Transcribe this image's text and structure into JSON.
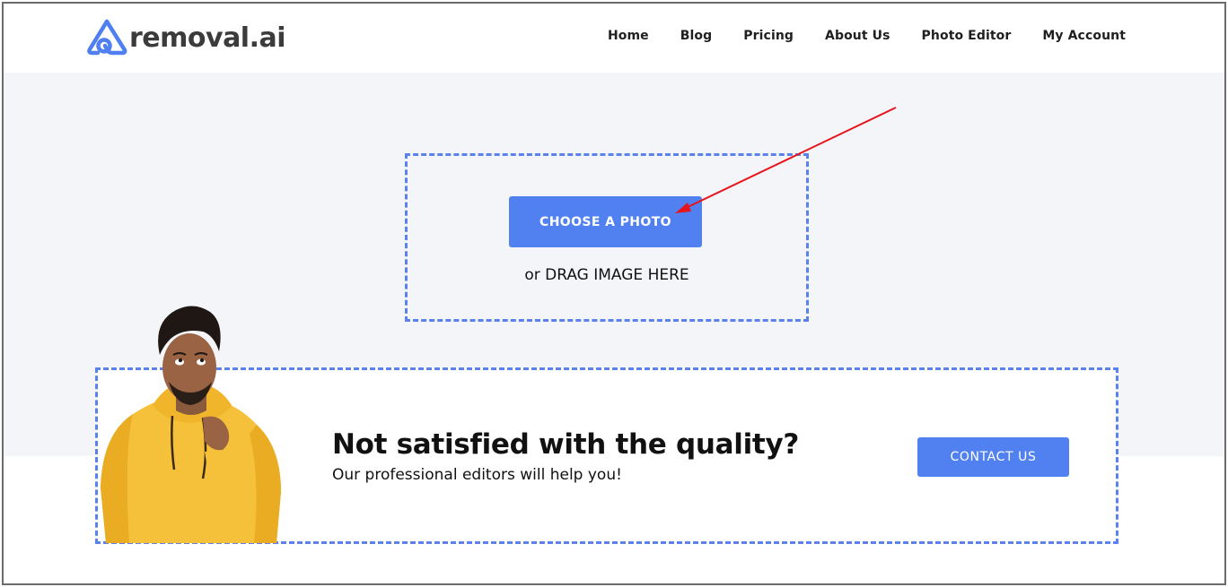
{
  "header": {
    "logo_text": "removal.ai",
    "nav": [
      {
        "label": "Home"
      },
      {
        "label": "Blog"
      },
      {
        "label": "Pricing"
      },
      {
        "label": "About Us"
      },
      {
        "label": "Photo Editor"
      },
      {
        "label": "My Account"
      }
    ]
  },
  "upload": {
    "button_label": "CHOOSE A PHOTO",
    "drag_text": "or DRAG IMAGE HERE"
  },
  "banner": {
    "title": "Not satisfied with the quality?",
    "subtitle": "Our professional editors will help you!",
    "contact_label": "CONTACT US"
  },
  "colors": {
    "accent": "#5181f1",
    "dash_border": "#5b82ec",
    "hero_bg": "#f4f5f8",
    "annotation_arrow": "#e8141c",
    "hoodie": "#f6c13a"
  },
  "icons": {
    "logo": "removal-ai-logo-icon",
    "annotation": "red-arrow-annotation"
  }
}
